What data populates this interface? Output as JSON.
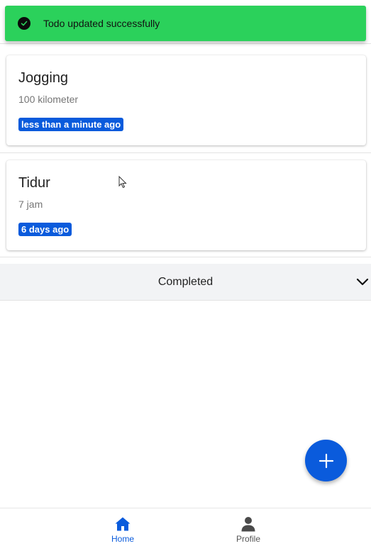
{
  "toast": {
    "message": "Todo updated successfully",
    "icon": "check-circle-icon",
    "color": "#2bd15b"
  },
  "todos": [
    {
      "title": "Jogging",
      "description": "100 kilometer",
      "time": "less than a minute ago"
    },
    {
      "title": "Tidur",
      "description": "7 jam",
      "time": "6 days ago"
    }
  ],
  "completed_section": {
    "label": "Completed",
    "icon": "chevron-down-icon"
  },
  "fab": {
    "icon": "plus-icon"
  },
  "bottom_nav": {
    "items": [
      {
        "label": "Home",
        "icon": "home-icon",
        "active": true
      },
      {
        "label": "Profile",
        "icon": "person-icon",
        "active": false
      }
    ]
  },
  "colors": {
    "accent": "#0a5bdc",
    "success": "#2bd15b"
  }
}
